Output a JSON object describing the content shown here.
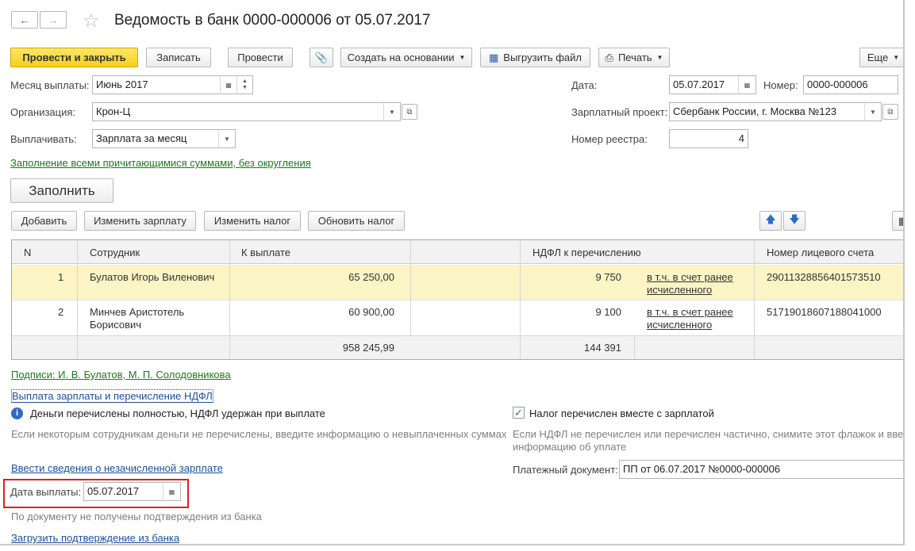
{
  "window": {
    "title": "Ведомость в банк 0000-000006 от 05.07.2017"
  },
  "toolbar": {
    "post_close": "Провести и закрыть",
    "save": "Записать",
    "post": "Провести",
    "create_based": "Создать на основании",
    "export_file": "Выгрузить файл",
    "print": "Печать",
    "more": "Еще"
  },
  "form": {
    "month_label": "Месяц выплаты:",
    "month_value": "Июнь 2017",
    "org_label": "Организация:",
    "org_value": "Крон-Ц",
    "pay_label": "Выплачивать:",
    "pay_value": "Зарплата за месяц",
    "date_label": "Дата:",
    "date_value": "05.07.2017",
    "number_label": "Номер:",
    "number_value": "0000-000006",
    "project_label": "Зарплатный проект:",
    "project_value": "Сбербанк России, г. Москва №123",
    "registry_label": "Номер реестра:",
    "registry_value": "4",
    "fill_mode_link": "Заполнение всеми причитающимися суммами, без округления",
    "fill_button": "Заполнить"
  },
  "table_toolbar": {
    "add": "Добавить",
    "change_salary": "Изменить зарплату",
    "change_tax": "Изменить налог",
    "update_tax": "Обновить налог"
  },
  "table": {
    "headers": [
      "N",
      "Сотрудник",
      "К выплате",
      "НДФЛ к перечислению",
      "Номер лицевого счета"
    ],
    "rows": [
      {
        "n": "1",
        "employee": "Булатов Игорь Виленович",
        "employee2": "",
        "amount": "65 250,00",
        "tax": "9 750",
        "tax_link1": "в т.ч. в счет ранее",
        "tax_link2": "исчисленного",
        "account": "29011328856401573510"
      },
      {
        "n": "2",
        "employee": "Минчев Аристотель",
        "employee2": "Борисович",
        "amount": "60 900,00",
        "tax": "9 100",
        "tax_link1": "в т.ч. в счет ранее",
        "tax_link2": "исчисленного",
        "account": "51719018607188041000"
      }
    ],
    "total_amount": "958 245,99",
    "total_tax": "144 391"
  },
  "bottom": {
    "signatures_link": "Подписи: И. В. Булатов, М. П. Солодовникова",
    "payment_link": "Выплата зарплаты и перечисление НДФЛ",
    "money_status": "Деньги перечислены  полностью, НДФЛ удержан при выплате",
    "money_hint": "Если некоторым сотрудникам деньги не перечислены, введите информацию о невыплаченных суммах",
    "tax_checkbox_label": "Налог перечислен вместе с зарплатой",
    "tax_hint1": "Если НДФЛ не перечислен или перечислен частично, снимите этот флажок и введ",
    "tax_hint2": "информацию об уплате",
    "unaccrued_link": "Ввести сведения о незачисленной зарплате",
    "payment_doc_label": "Платежный документ:",
    "payment_doc_value": "ПП от 06.07.2017 №0000-000006",
    "pay_date_label": "Дата выплаты:",
    "pay_date_value": "05.07.2017",
    "no_confirm_hint": "По документу не получены подтверждения из банка",
    "load_confirm_link": "Загрузить подтверждение из банка"
  },
  "colors": {
    "primary": "#f6cf1a",
    "link_green": "#1a7a1a",
    "link_blue": "#1c4fa0",
    "highlight_row": "#fbf4c4",
    "red_frame": "#e0201a"
  },
  "icons": [
    "back-arrow-icon",
    "forward-arrow-icon",
    "star-icon",
    "paperclip-icon",
    "export-icon",
    "printer-icon",
    "calendar-icon",
    "open-icon",
    "arrow-up-icon",
    "arrow-down-icon",
    "info-icon",
    "checkbox-icon"
  ]
}
